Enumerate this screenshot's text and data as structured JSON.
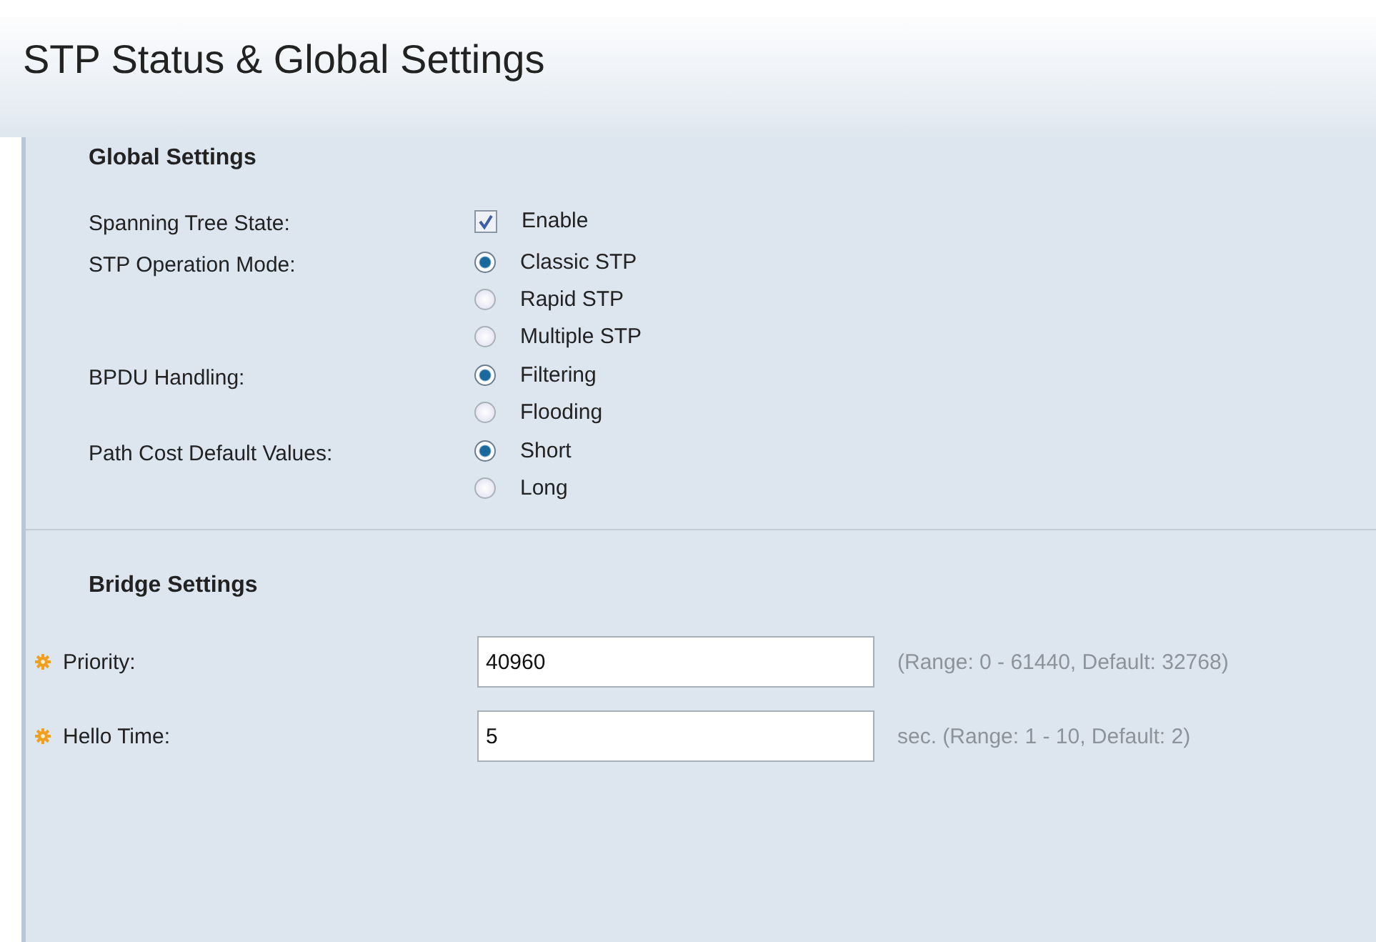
{
  "title": "STP Status & Global Settings",
  "global_settings": {
    "heading": "Global Settings",
    "rows": [
      {
        "label": "Spanning Tree State:",
        "kind": "checkbox",
        "options": [
          {
            "label": "Enable",
            "checked": true
          }
        ]
      },
      {
        "label": "STP Operation Mode:",
        "kind": "radio",
        "options": [
          {
            "label": "Classic STP",
            "selected": true
          },
          {
            "label": "Rapid STP",
            "selected": false
          },
          {
            "label": "Multiple STP",
            "selected": false
          }
        ]
      },
      {
        "label": "BPDU Handling:",
        "kind": "radio",
        "options": [
          {
            "label": "Filtering",
            "selected": true
          },
          {
            "label": "Flooding",
            "selected": false
          }
        ]
      },
      {
        "label": "Path Cost Default Values:",
        "kind": "radio",
        "options": [
          {
            "label": "Short",
            "selected": true
          },
          {
            "label": "Long",
            "selected": false
          }
        ]
      }
    ]
  },
  "bridge_settings": {
    "heading": "Bridge Settings",
    "fields": [
      {
        "label": "Priority:",
        "required": true,
        "value": "40960",
        "hint": "(Range: 0 - 61440, Default: 32768)"
      },
      {
        "label": "Hello Time:",
        "required": true,
        "value": "5",
        "hint": "sec. (Range: 1 - 10, Default: 2)"
      }
    ]
  }
}
